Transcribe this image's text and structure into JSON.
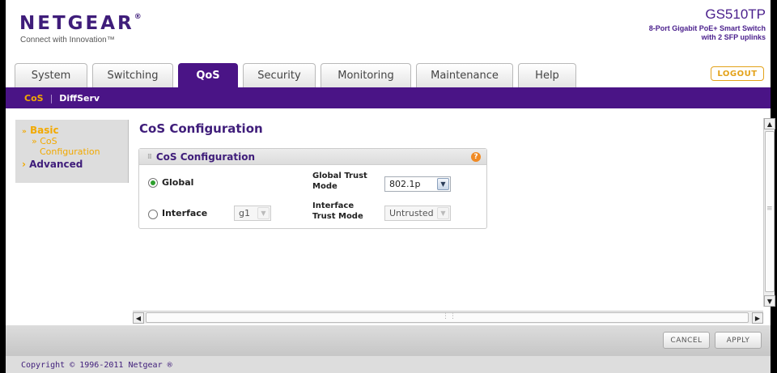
{
  "header": {
    "brand": "NETGEAR",
    "brand_mark": "®",
    "tagline": "Connect with Innovation™",
    "model": "GS510TP",
    "model_desc_line1": "8-Port Gigabit PoE+ Smart Switch",
    "model_desc_line2": "with 2 SFP uplinks",
    "logout_label": "LOGOUT"
  },
  "tabs": [
    {
      "label": "System",
      "active": false
    },
    {
      "label": "Switching",
      "active": false
    },
    {
      "label": "QoS",
      "active": true
    },
    {
      "label": "Security",
      "active": false
    },
    {
      "label": "Monitoring",
      "active": false
    },
    {
      "label": "Maintenance",
      "active": false
    },
    {
      "label": "Help",
      "active": false
    }
  ],
  "subnav": {
    "items": [
      {
        "label": "CoS",
        "active": true
      },
      {
        "label": "DiffServ",
        "active": false
      }
    ],
    "separator": "|"
  },
  "leftnav": {
    "basic_label": "Basic",
    "basic_marker": "»",
    "cos_line1": "» CoS",
    "cos_line2": "Configuration",
    "advanced_label": "Advanced",
    "advanced_marker": "›"
  },
  "main": {
    "page_title": "CoS Configuration",
    "panel_title": "CoS Configuration",
    "help_symbol": "?",
    "global_label": "Global",
    "global_selected": true,
    "global_trust_mode_label_1": "Global Trust",
    "global_trust_mode_label_2": "Mode",
    "global_trust_mode_value": "802.1p",
    "interface_label": "Interface",
    "interface_selected": false,
    "interface_value": "g1",
    "interface_trust_mode_label_1": "Interface",
    "interface_trust_mode_label_2": "Trust Mode",
    "interface_trust_mode_value": "Untrusted"
  },
  "scrollbars": {
    "up": "▲",
    "down": "▼",
    "left": "◀",
    "right": "▶",
    "grip": "≡"
  },
  "actions": {
    "cancel_label": "CANCEL",
    "apply_label": "APPLY"
  },
  "footer": {
    "copyright": "Copyright © 1996-2011 Netgear ®"
  },
  "colors": {
    "brand_purple": "#4a1486",
    "accent_orange": "#f2a900",
    "radio_green": "#2d9f2d"
  }
}
